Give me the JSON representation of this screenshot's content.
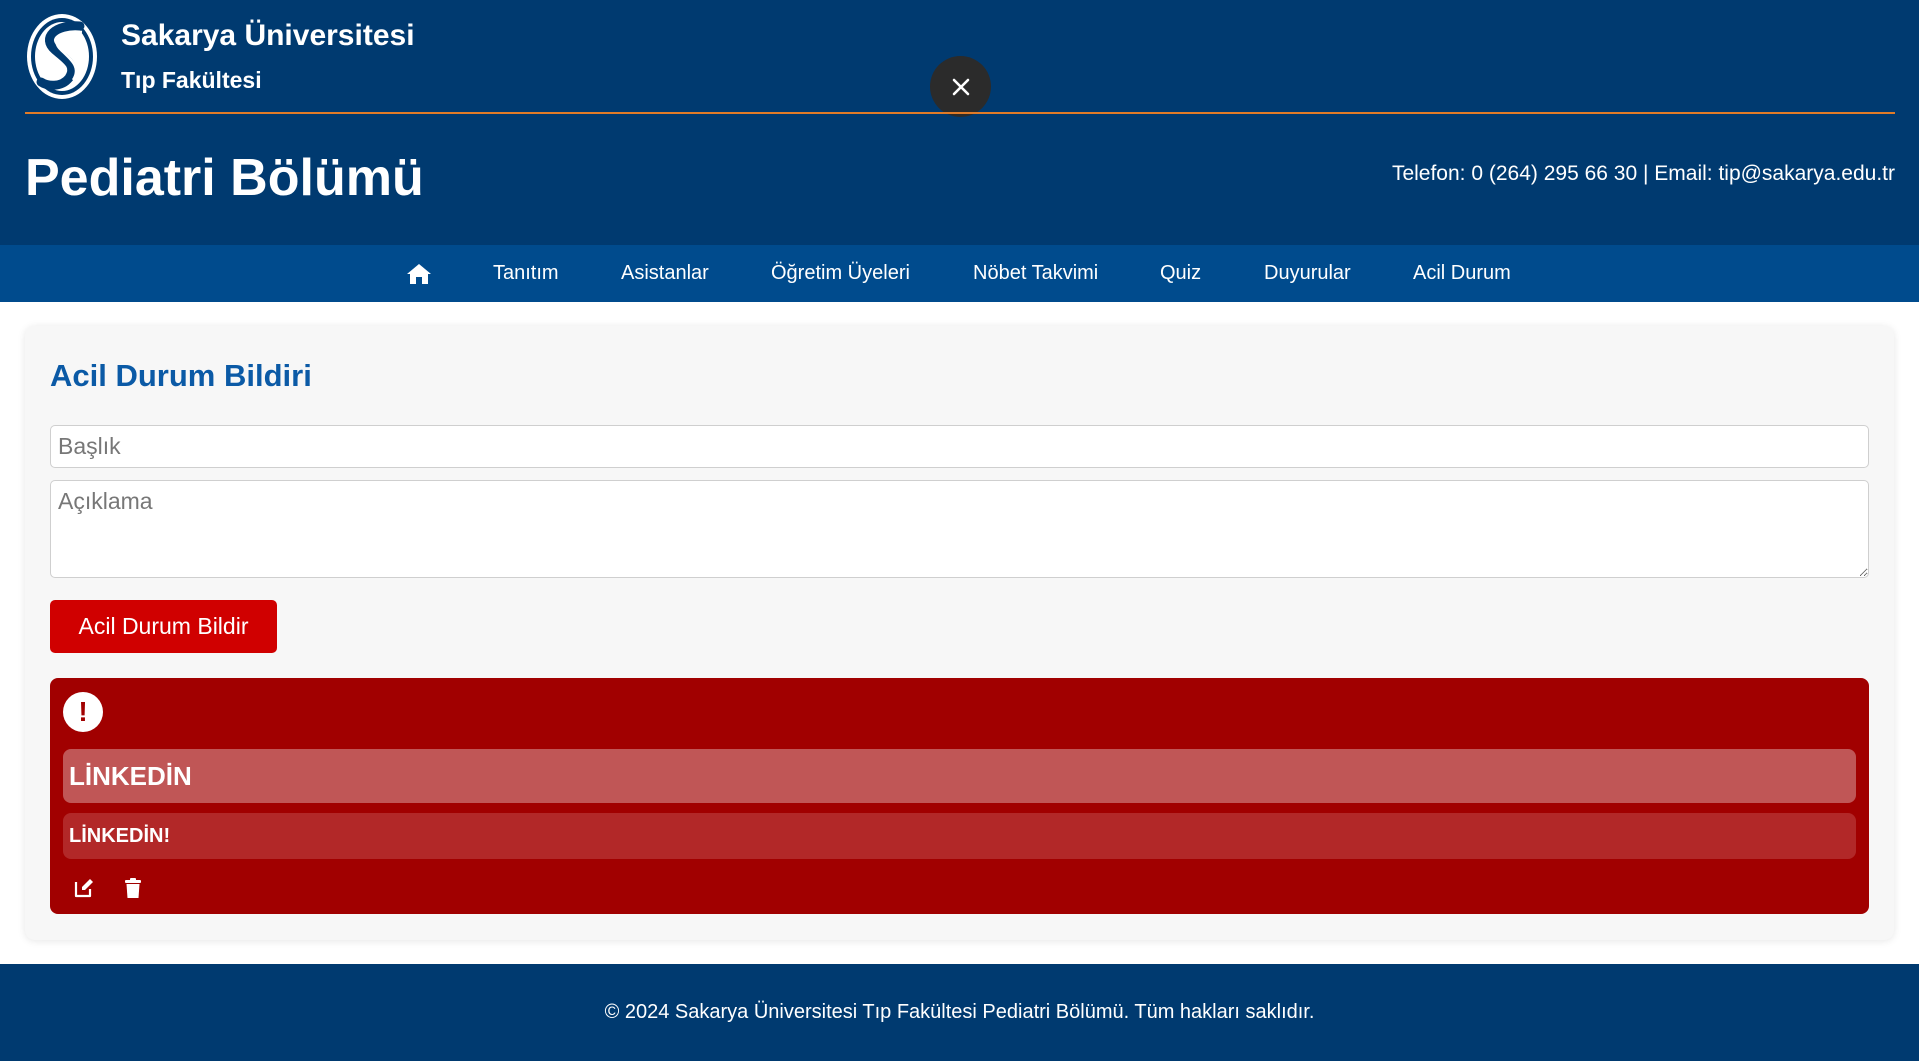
{
  "header": {
    "university_name": "Sakarya Üniversitesi",
    "faculty_name": "Tıp Fakültesi",
    "department_title": "Pediatri Bölümü",
    "contact": "Telefon: 0 (264) 295 66 30 | Email: tip@sakarya.edu.tr",
    "logo_icon": "sakarya-logo-icon",
    "close_icon": "close-icon"
  },
  "nav": {
    "home_icon": "home-icon",
    "items": [
      {
        "label": "Tanıtım"
      },
      {
        "label": "Asistanlar"
      },
      {
        "label": "Öğretim Üyeleri"
      },
      {
        "label": "Nöbet Takvimi"
      },
      {
        "label": "Quiz"
      },
      {
        "label": "Duyurular"
      },
      {
        "label": "Acil Durum"
      }
    ]
  },
  "form": {
    "title": "Acil Durum Bildiri",
    "title_placeholder": "Başlık",
    "title_value": "",
    "description_placeholder": "Açıklama",
    "description_value": "",
    "submit_label": "Acil Durum Bildir"
  },
  "alerts": [
    {
      "icon": "exclamation-icon",
      "icon_text": "!",
      "title": "LİNKEDİN",
      "description": "LİNKEDİN!",
      "edit_icon": "edit-icon",
      "delete_icon": "trash-icon"
    }
  ],
  "footer": {
    "text": "© 2024 Sakarya Üniversitesi Tıp Fakültesi Pediatri Bölümü. Tüm hakları saklıdır."
  },
  "colors": {
    "header_bg": "#003a70",
    "nav_bg": "#004b8d",
    "accent_line": "#e07b28",
    "card_title": "#0b5aa6",
    "danger_button": "#d00000",
    "alert_bg": "#a10000",
    "alert_title_bg": "#c05656",
    "alert_desc_bg": "#b22828"
  }
}
